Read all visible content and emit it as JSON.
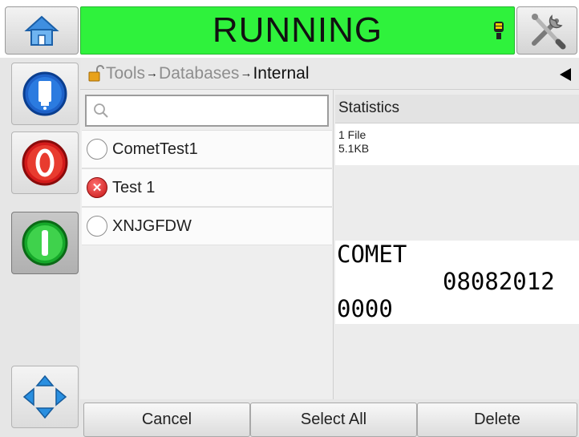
{
  "status": {
    "text": "RUNNING",
    "color": "#2ff23c"
  },
  "breadcrumb": {
    "part1": "Tools",
    "part2": "Databases",
    "current": "Internal",
    "separator": "→"
  },
  "search": {
    "placeholder": ""
  },
  "list": {
    "items": [
      {
        "label": "CometTest1",
        "state": "unselected"
      },
      {
        "label": "Test 1",
        "state": "error"
      },
      {
        "label": "XNJGFDW",
        "state": "unselected"
      }
    ]
  },
  "stats": {
    "header": "Statistics",
    "files": "1 File",
    "size": "5.1KB"
  },
  "preview": {
    "line1": "COMET",
    "line2": "08082012",
    "line3": "0000"
  },
  "buttons": {
    "cancel": "Cancel",
    "select_all": "Select All",
    "delete": "Delete"
  },
  "icons": {
    "home": "home-icon",
    "tools": "tools-icon",
    "beacon": "beacon-icon",
    "ink": "ink-cartridge-icon",
    "stop": "stop-icon",
    "start": "start-icon",
    "nav": "navigation-arrows-icon"
  }
}
